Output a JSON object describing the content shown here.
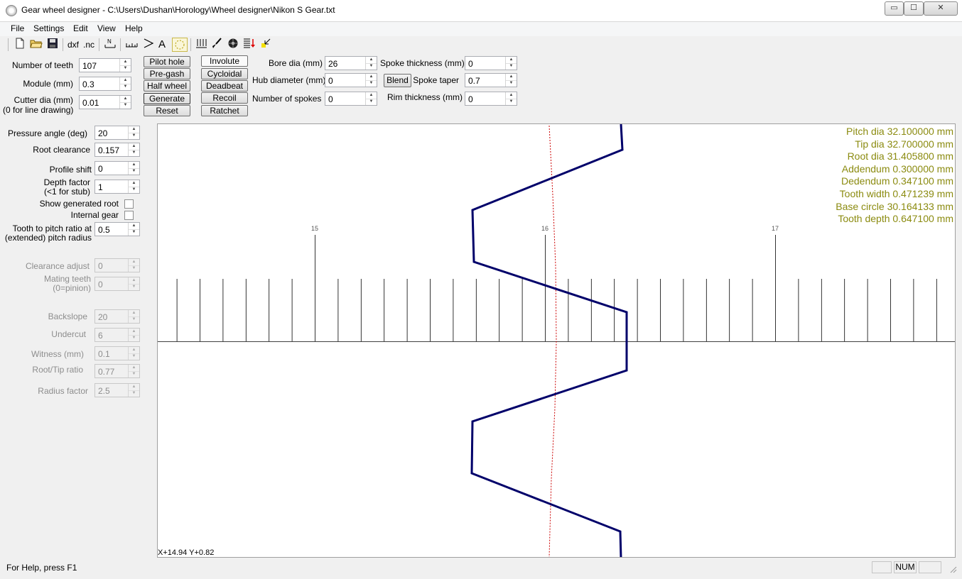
{
  "window": {
    "title": "Gear wheel designer - C:\\Users\\Dushan\\Horology\\Wheel designer\\Nikon S Gear.txt",
    "minimize_glyph": "▭",
    "maximize_glyph": "☐",
    "close_glyph": "✕"
  },
  "menu": [
    "File",
    "Settings",
    "Edit",
    "View",
    "Help"
  ],
  "toolbar": {
    "dxf_label": "dxf",
    "nc_label": ".nc",
    "text_tool_label": "A"
  },
  "params": {
    "teeth": {
      "label": "Number of teeth",
      "value": "107"
    },
    "module": {
      "label": "Module (mm)",
      "value": "0.3"
    },
    "cutter": {
      "label_line1": "Cutter dia (mm)",
      "label_line2": "(0 for line drawing)",
      "value": "0.01"
    }
  },
  "action_buttons": [
    "Pilot hole",
    "Pre-gash",
    "Half wheel",
    "Generate",
    "Reset"
  ],
  "type_buttons": [
    "Involute",
    "Cycloidal",
    "Deadbeat",
    "Recoil",
    "Ratchet"
  ],
  "hub": {
    "bore": {
      "label": "Bore dia (mm)",
      "value": "26"
    },
    "hub_dia": {
      "label": "Hub diameter (mm)",
      "value": "0"
    },
    "spokes": {
      "label": "Number of spokes",
      "value": "0"
    },
    "blend_label": "Blend",
    "spoke_thickness": {
      "label": "Spoke thickness (mm)",
      "value": "0"
    },
    "spoke_taper": {
      "label": "Spoke taper",
      "value": "0.7"
    },
    "rim": {
      "label": "Rim thickness (mm)",
      "value": "0"
    }
  },
  "involute": {
    "pressure_angle": {
      "label": "Pressure angle (deg)",
      "value": "20"
    },
    "root_clearance": {
      "label": "Root clearance",
      "value": "0.157"
    },
    "profile_shift": {
      "label": "Profile shift",
      "value": "0"
    },
    "depth_factor": {
      "label_line1": "Depth factor",
      "label_line2": "(<1 for stub)",
      "value": "1"
    },
    "show_root_label": "Show generated root",
    "internal_label": "Internal gear",
    "tooth_ratio": {
      "label_line1": "Tooth to pitch ratio at",
      "label_line2": "(extended) pitch radius",
      "value": "0.5"
    }
  },
  "disabled_params": {
    "clearance_adjust": {
      "label": "Clearance adjust",
      "value": "0"
    },
    "mating_teeth": {
      "label_line1": "Mating teeth",
      "label_line2": "(0=pinion)",
      "value": "0"
    },
    "backslope": {
      "label": "Backslope",
      "value": "20"
    },
    "undercut": {
      "label": "Undercut",
      "value": "6"
    },
    "witness": {
      "label": "Witness (mm)",
      "value": "0.1"
    },
    "root_tip": {
      "label": "Root/Tip ratio",
      "value": "0.77"
    },
    "radius_factor": {
      "label": "Radius factor",
      "value": "2.5"
    }
  },
  "chart_data": {
    "type": "line",
    "ruler_ticks": [
      "15",
      "16",
      "17"
    ],
    "info_lines": [
      "Pitch dia 32.100000 mm",
      "Tip dia 32.700000 mm",
      "Root dia 31.405800 mm",
      "Addendum 0.300000 mm",
      "Dedendum 0.347100 mm",
      "Tooth width 0.471239 mm",
      "Base circle 30.164133 mm",
      "Tooth depth 0.647100 mm"
    ],
    "info_color": "#8b8b10",
    "profile_color": "#00006a",
    "pitch_line_color": "#cc0000",
    "pitch_radius": 16.05,
    "tip_radius": 16.35,
    "root_radius": 15.7029
  },
  "coord_readout": "X+14.94 Y+0.82",
  "status": {
    "help_text": "For Help, press F1",
    "num_indicator": "NUM"
  }
}
